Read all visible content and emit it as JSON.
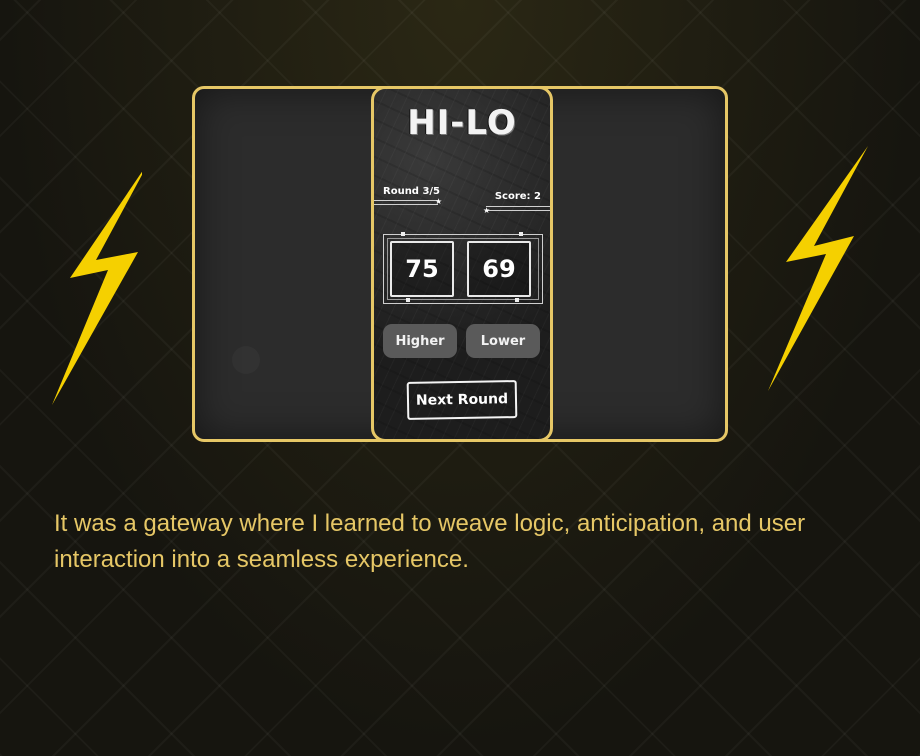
{
  "colors": {
    "accent": "#e6c766",
    "bolt": "#f5d000",
    "background": "#16150f"
  },
  "icons": {
    "left_decoration": "lightning-bolt-icon",
    "right_decoration": "lightning-bolt-icon"
  },
  "game": {
    "logo": "HI-LO",
    "round": "Round 3/5",
    "score": "Score: 2",
    "card_left": "75",
    "card_right": "69",
    "higher_label": "Higher",
    "lower_label": "Lower",
    "next_label": "Next Round"
  },
  "caption": "It was a gateway where I learned to weave logic, anticipation, and user interaction into a seamless experience."
}
